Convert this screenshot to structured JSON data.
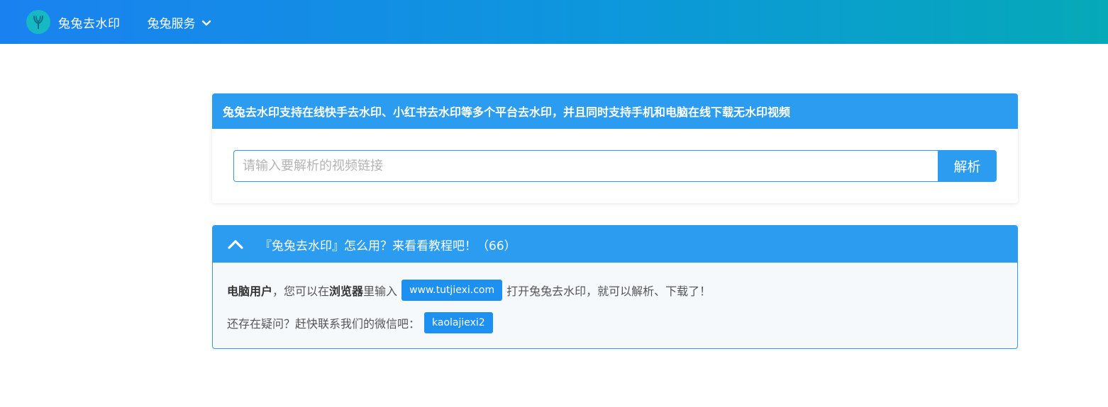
{
  "header": {
    "brand_name": "兔兔去水印",
    "service_menu_label": "兔兔服务",
    "logo_icon": "logo-icon"
  },
  "parse_card": {
    "title": "兔兔去水印支持在线快手去水印、小红书去水印等多个平台去水印，并且同时支持手机和电脑在线下载无水印视频",
    "input_placeholder": "请输入要解析的视频链接",
    "input_value": "",
    "button_label": "解析"
  },
  "tutorial_card": {
    "title": "『兔兔去水印』怎么用？来看看教程吧！（66）",
    "line1": {
      "bold1": "电脑用户",
      "text1": "，您可以在",
      "bold2": "浏览器",
      "text2": "里输入",
      "url_tag": "www.tutjiexi.com",
      "text3": "打开兔兔去水印，就可以解析、下载了！"
    },
    "line2": {
      "text": "还存在疑问？赶快联系我们的微信吧：",
      "wechat_tag": "kaolajiexi2"
    }
  },
  "colors": {
    "primary": "#2b9cef",
    "header_gradient_start": "#1a82f0",
    "header_gradient_end": "#05a9b8"
  }
}
